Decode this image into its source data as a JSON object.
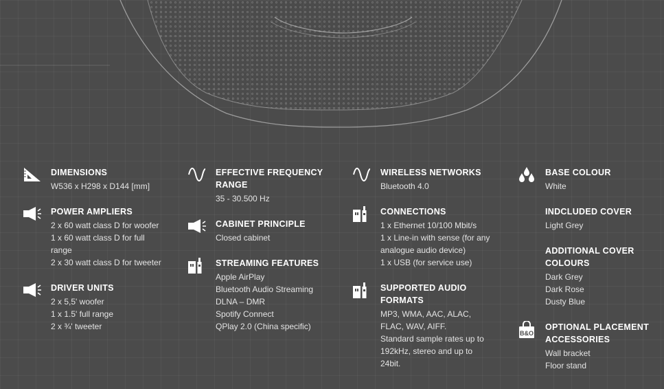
{
  "specs": {
    "dimensions": {
      "title": "DIMENSIONS",
      "lines": [
        "W536 x H298 x D144 [mm]"
      ],
      "icon": "ruler-triangle-icon"
    },
    "power_amplifiers": {
      "title": "POWER AMPLIERS",
      "lines": [
        "2 x 60 watt class D for woofer",
        "1 x 60 watt class D for full",
        "range",
        "2 x 30 watt class D for tweeter"
      ],
      "icon": "speaker-icon"
    },
    "driver_units": {
      "title": "DRIVER UNITS",
      "lines": [
        "2 x 5,5' woofer",
        "1 x 1.5' full range",
        "2 x ¾' tweeter"
      ],
      "icon": "speaker-icon"
    },
    "effective_frequency_range": {
      "title": "EFFECTIVE FREQUENCY RANGE",
      "lines": [
        "35 - 30.500 Hz"
      ],
      "icon": "sine-wave-icon"
    },
    "cabinet_principle": {
      "title": "CABINET PRINCIPLE",
      "lines": [
        "Closed cabinet"
      ],
      "icon": "speaker-icon"
    },
    "streaming_features": {
      "title": "STREAMING FEATURES",
      "lines": [
        "Apple AirPlay",
        "Bluetooth Audio Streaming",
        "DLNA – DMR",
        "Spotify Connect",
        "QPlay 2.0 (China specific)"
      ],
      "icon": "connector-icon"
    },
    "wireless_networks": {
      "title": "WIRELESS NETWORKS",
      "lines": [
        "Bluetooth 4.0"
      ],
      "icon": "sine-wave-icon"
    },
    "connections": {
      "title": "CONNECTIONS",
      "lines": [
        "1 x Ethernet 10/100 Mbit/s",
        "1 x Line-in with sense (for any",
        "analogue audio device)",
        "1 x USB (for service use)"
      ],
      "icon": "connector-icon"
    },
    "supported_audio_formats": {
      "title": "SUPPORTED AUDIO FORMATS",
      "lines": [
        "MP3, WMA, AAC, ALAC,",
        "FLAC, WAV, AIFF.",
        "Standard sample rates up to",
        "192kHz, stereo and up to",
        "24bit."
      ],
      "icon": "connector-icon"
    },
    "base_colour": {
      "title": "BASE COLOUR",
      "lines": [
        "White"
      ],
      "icon": "color-drops-icon"
    },
    "included_cover": {
      "title": "INDCLUDED COVER",
      "lines": [
        "Light Grey"
      ]
    },
    "additional_cover_colours": {
      "title": "ADDITIONAL COVER COLOURS",
      "lines": [
        "Dark Grey",
        "Dark Rose",
        "Dusty Blue"
      ]
    },
    "optional_placement_accessories": {
      "title": "OPTIONAL PLACEMENT ACCESSORIES",
      "lines": [
        "Wall bracket",
        "Floor stand"
      ],
      "icon": "shopping-bag-icon",
      "icon_text": "B&O"
    }
  },
  "colors": {
    "background": "#4b4b4b",
    "text": "#ffffff"
  }
}
